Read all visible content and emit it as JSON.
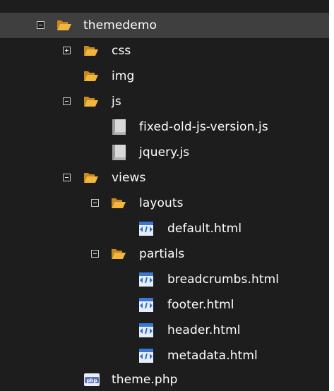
{
  "tree": {
    "themedemo": {
      "label": "themedemo",
      "icon": "folder-open-icon",
      "expanded": true
    },
    "css": {
      "label": "css",
      "icon": "folder-open-icon",
      "expanded": false
    },
    "img": {
      "label": "img",
      "icon": "folder-open-icon"
    },
    "js": {
      "label": "js",
      "icon": "folder-open-icon",
      "expanded": true
    },
    "js_fixed": {
      "label": "fixed-old-js-version.js",
      "icon": "file-icon"
    },
    "js_jquery": {
      "label": "jquery.js",
      "icon": "file-icon"
    },
    "views": {
      "label": "views",
      "icon": "folder-open-icon",
      "expanded": true
    },
    "layouts": {
      "label": "layouts",
      "icon": "folder-open-icon",
      "expanded": true
    },
    "default": {
      "label": "default.html",
      "icon": "html-file-icon"
    },
    "partials": {
      "label": "partials",
      "icon": "folder-open-icon",
      "expanded": true
    },
    "breadcrumbs": {
      "label": "breadcrumbs.html",
      "icon": "html-file-icon"
    },
    "footer": {
      "label": "footer.html",
      "icon": "html-file-icon"
    },
    "header": {
      "label": "header.html",
      "icon": "html-file-icon"
    },
    "metadata": {
      "label": "metadata.html",
      "icon": "html-file-icon"
    },
    "theme": {
      "label": "theme.php",
      "icon": "php-file-icon"
    }
  },
  "colors": {
    "background": "#1d1d1d",
    "selected_row": "#3f3f3f",
    "folder": "#f0b73a",
    "text": "#ffffff"
  }
}
